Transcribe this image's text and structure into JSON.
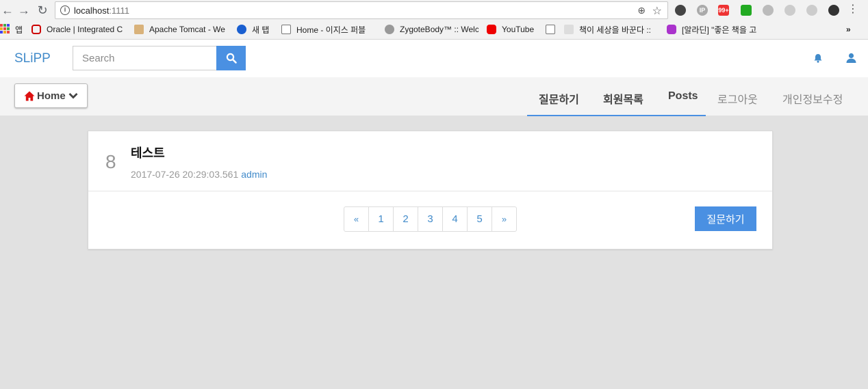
{
  "browser": {
    "url_host": "localhost",
    "url_port": ":1111",
    "extensions": [
      "IP",
      "99+"
    ],
    "bookmarks": [
      {
        "label": "앱",
        "icon": "apps-icon"
      },
      {
        "label": "Oracle | Integrated C",
        "icon": "oracle-icon"
      },
      {
        "label": "Apache Tomcat - We",
        "icon": "tomcat-icon"
      },
      {
        "label": "새 탭",
        "icon": "new-tab-icon"
      },
      {
        "label": "Home - 이지스 퍼블",
        "icon": "page-icon"
      },
      {
        "label": "ZygoteBody™ :: Welc",
        "icon": "zygote-icon"
      },
      {
        "label": "YouTube",
        "icon": "youtube-icon"
      },
      {
        "label": "",
        "icon": "page-icon"
      },
      {
        "label": "책이 세상을 바꾼다 ::",
        "icon": "book-icon"
      },
      {
        "label": "[알라딘] \"좋은 책을 고",
        "icon": "aladin-icon"
      }
    ],
    "more_bookmarks": "»"
  },
  "navbar": {
    "brand": "SLiPP",
    "search_placeholder": "Search"
  },
  "subnav": {
    "home_label": "Home",
    "tabs": [
      {
        "label": "질문하기",
        "active": true
      },
      {
        "label": "회원목록",
        "active": true
      },
      {
        "label": "Posts",
        "active": true
      },
      {
        "label": "로그아웃",
        "active": false
      },
      {
        "label": "개인정보수정",
        "active": false
      }
    ]
  },
  "post": {
    "number": "8",
    "title": "테스트",
    "datetime": "2017-07-26 20:29:03.561",
    "author": "admin"
  },
  "pagination": [
    "«",
    "1",
    "2",
    "3",
    "4",
    "5",
    "»"
  ],
  "ask_button": "질문하기",
  "colors": {
    "accent": "#4a90e2",
    "brand": "#428bca",
    "home_icon": "#d11"
  }
}
